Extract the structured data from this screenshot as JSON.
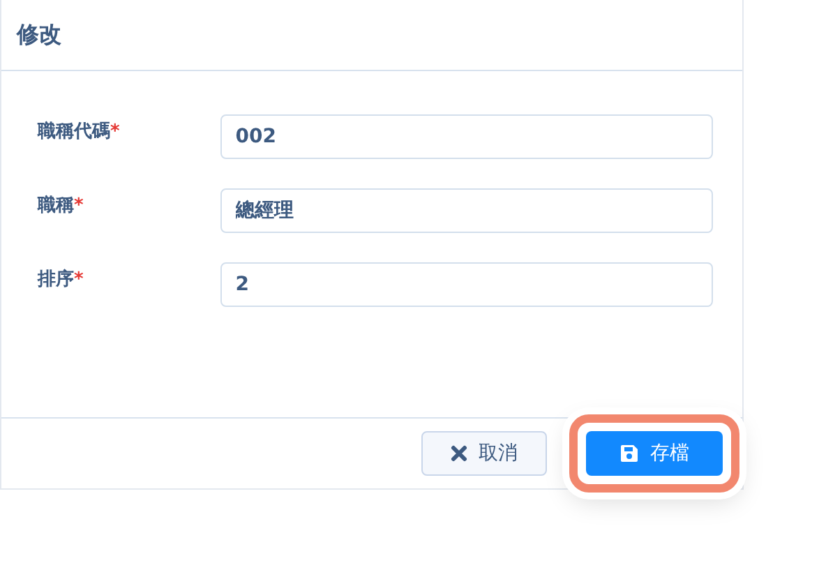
{
  "dialog": {
    "title": "修改"
  },
  "fields": [
    {
      "label": "職稱代碼",
      "required_mark": "*",
      "value": "002"
    },
    {
      "label": "職稱",
      "required_mark": "*",
      "value": "總經理"
    },
    {
      "label": "排序",
      "required_mark": "*",
      "value": "2"
    }
  ],
  "buttons": [
    {
      "kind": "cancel",
      "label": "取消",
      "highlighted": false
    },
    {
      "kind": "save",
      "label": "存檔",
      "highlighted": true
    }
  ]
}
